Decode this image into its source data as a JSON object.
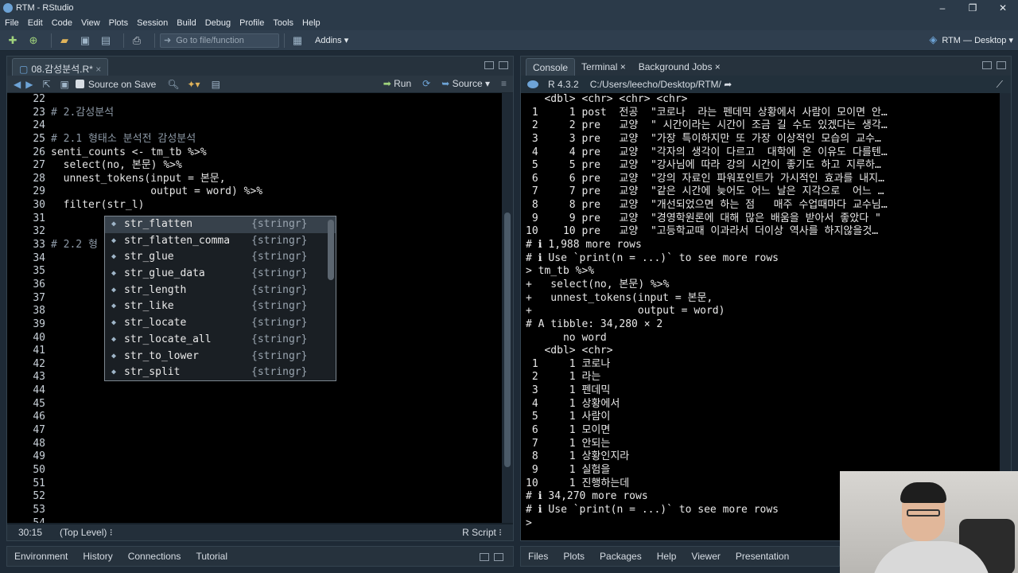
{
  "window": {
    "title": "RTM - RStudio",
    "controls": [
      "–",
      "❐",
      "✕"
    ]
  },
  "menu": [
    "File",
    "Edit",
    "Code",
    "View",
    "Plots",
    "Session",
    "Build",
    "Debug",
    "Profile",
    "Tools",
    "Help"
  ],
  "toolbar": {
    "goto_placeholder": "Go to file/function",
    "addins": "Addins ▾",
    "project": "RTM — Desktop ▾"
  },
  "editor": {
    "tab": "08.감성분석.R*",
    "source_on_save": "Source on Save",
    "run": "Run",
    "source": "Source ▾",
    "line_numbers": [
      "22",
      "23",
      "24",
      "25",
      "26",
      "27",
      "28",
      "29",
      "30",
      "31",
      "32",
      "33",
      "34",
      "35",
      "36",
      "37",
      "38",
      "39",
      "40",
      "41",
      "42",
      "43",
      "44",
      "45",
      "46",
      "47",
      "48",
      "49",
      "50",
      "51",
      "52",
      "53",
      "54"
    ],
    "lines": [
      "",
      "# 2.감성분석",
      "",
      "# 2.1 형태소 분석전 감성분석",
      "senti_counts <- tm_tb %>%",
      "  select(no, 본문) %>%",
      "  unnest_tokens(input = 본문,",
      "                output = word) %>%",
      "  filter(str_l)",
      "",
      "",
      "# 2.2 형"
    ],
    "status": {
      "position": "30:15",
      "level": "(Top Level) ⁝",
      "type": "R Script ⁝"
    },
    "autocomplete": [
      {
        "name": "str_flatten",
        "pkg": "{stringr}"
      },
      {
        "name": "str_flatten_comma",
        "pkg": "{stringr}"
      },
      {
        "name": "str_glue",
        "pkg": "{stringr}"
      },
      {
        "name": "str_glue_data",
        "pkg": "{stringr}"
      },
      {
        "name": "str_length",
        "pkg": "{stringr}"
      },
      {
        "name": "str_like",
        "pkg": "{stringr}"
      },
      {
        "name": "str_locate",
        "pkg": "{stringr}"
      },
      {
        "name": "str_locate_all",
        "pkg": "{stringr}"
      },
      {
        "name": "str_to_lower",
        "pkg": "{stringr}"
      },
      {
        "name": "str_split",
        "pkg": "{stringr}"
      }
    ]
  },
  "console": {
    "tabs": [
      "Console",
      "Terminal ×",
      "Background Jobs ×"
    ],
    "version": "R 4.3.2",
    "path": "C:/Users/leecho/Desktop/RTM/ ➦",
    "lines": [
      "   <dbl> <chr> <chr> <chr>",
      " 1     1 post  전공  \"코로나  라는 펜데믹 상황에서 사람이 모이면 안…",
      " 2     2 pre   교양  \" 시간이라는 시간이 조금 길 수도 있겠다는 생각…",
      " 3     3 pre   교양  \"가장 특이하지만 또 가장 이상적인 모습의 교수…",
      " 4     4 pre   교양  \"각자의 생각이 다르고  대학에 온 이유도 다를텐…",
      " 5     5 pre   교양  \"강사님에 따라 강의 시간이 좋기도 하고 지루하…",
      " 6     6 pre   교양  \"강의 자료인 파워포인트가 가시적인 효과를 내지…",
      " 7     7 pre   교양  \"같은 시간에 늦어도 어느 날은 지각으로  어느 …",
      " 8     8 pre   교양  \"개선되었으면 하는 점   매주 수업때마다 교수님…",
      " 9     9 pre   교양  \"경영학원론에 대해 많은 배움을 받아서 좋았다 \"",
      "10    10 pre   교양  \"고등학교때 이과라서 더이상 역사를 하지않을것…",
      "# ℹ 1,988 more rows",
      "# ℹ Use `print(n = ...)` to see more rows",
      "> tm_tb %>%",
      "+   select(no, 본문) %>%",
      "+   unnest_tokens(input = 본문,",
      "+                 output = word)",
      "# A tibble: 34,280 × 2",
      "      no word",
      "   <dbl> <chr>",
      " 1     1 코로나",
      " 2     1 라는",
      " 3     1 펜데믹",
      " 4     1 상황에서",
      " 5     1 사람이",
      " 6     1 모이면",
      " 7     1 안되는",
      " 8     1 상황인지라",
      " 9     1 실험을",
      "10     1 진행하는데",
      "# ℹ 34,270 more rows",
      "# ℹ Use `print(n = ...)` to see more rows",
      "> "
    ]
  },
  "bottom_left_tabs": [
    "Environment",
    "History",
    "Connections",
    "Tutorial"
  ],
  "bottom_right_tabs": [
    "Files",
    "Plots",
    "Packages",
    "Help",
    "Viewer",
    "Presentation"
  ]
}
